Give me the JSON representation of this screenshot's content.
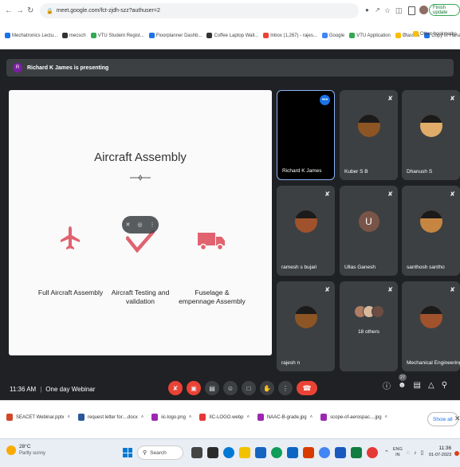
{
  "browser": {
    "url": "meet.google.com/fct-zjdh-szz?authuser=2",
    "finish_update_label": "Finish update"
  },
  "bookmarks": [
    {
      "label": "Mechatronics Lectu...",
      "color": "#1a73e8"
    },
    {
      "label": "mecsch",
      "color": "#333333"
    },
    {
      "label": "VTU Student Regist...",
      "color": "#34a853"
    },
    {
      "label": "Floorplanner Dashb...",
      "color": "#1a73e8"
    },
    {
      "label": "Coffee Laptop Wall...",
      "color": "#333333"
    },
    {
      "label": "Inbox (1,267) - rajes...",
      "color": "#ea4335"
    },
    {
      "label": "Google",
      "color": "#4285f4"
    },
    {
      "label": "VTU Application",
      "color": "#34a853"
    },
    {
      "label": "Classes",
      "color": "#fbbc04"
    },
    {
      "label": "Copy of Hanakkah...",
      "color": "#1a73e8"
    }
  ],
  "other_bookmarks": "Other bookmarks",
  "meet": {
    "presenter_initial": "R",
    "presenting_banner": "Richard K James is presenting",
    "slide": {
      "title": "Aircraft Assembly",
      "items": [
        {
          "label": "Full Aircraft Assembly",
          "icon": "airplane-icon"
        },
        {
          "label": "Aircraft Testing and validation",
          "icon": "checkmark-icon"
        },
        {
          "label": "Fuselage & empennage Assembly",
          "icon": "truck-icon"
        }
      ]
    },
    "participants": [
      {
        "name": "Richard K James",
        "type": "black"
      },
      {
        "name": "Kuber S B",
        "type": "photo"
      },
      {
        "name": "Dhanush S",
        "type": "photo"
      },
      {
        "name": "ramesh s bujari",
        "type": "photo"
      },
      {
        "name": "Ullas Ganesh",
        "type": "initial",
        "initial": "U"
      },
      {
        "name": "santhosh santho",
        "type": "photo"
      },
      {
        "name": "rajesh n",
        "type": "photo"
      },
      {
        "name": "18 others",
        "type": "others"
      },
      {
        "name": "Mechanical Engineering",
        "type": "photo"
      }
    ],
    "time": "11:36 AM",
    "separator": "|",
    "meeting_name": "One day Webinar",
    "people_count": "27"
  },
  "downloads": [
    {
      "label": "SEACET Webinar.pptx",
      "color": "#d24726"
    },
    {
      "label": "request letter for....docx",
      "color": "#2b579a"
    },
    {
      "label": "iic-logo.png",
      "color": "#9c27b0"
    },
    {
      "label": "IIC-LOGO.webp",
      "color": "#e53935"
    },
    {
      "label": "NAAC-B-grade.jpg",
      "color": "#9c27b0"
    },
    {
      "label": "scope-of-aerospac....jpg",
      "color": "#9c27b0"
    }
  ],
  "show_all": "Show all",
  "taskbar": {
    "weather_temp": "28°C",
    "weather_desc": "Partly sunny",
    "search_label": "Search",
    "lang_top": "ENG",
    "lang_bottom": "IN",
    "clock_time": "11:36",
    "clock_date": "01-07-2023"
  },
  "colors": {
    "meet_bg": "#202124",
    "tile_bg": "#3c4043",
    "end_call": "#ea4335",
    "slide_icon": "#e0636f",
    "accent": "#1a73e8"
  }
}
